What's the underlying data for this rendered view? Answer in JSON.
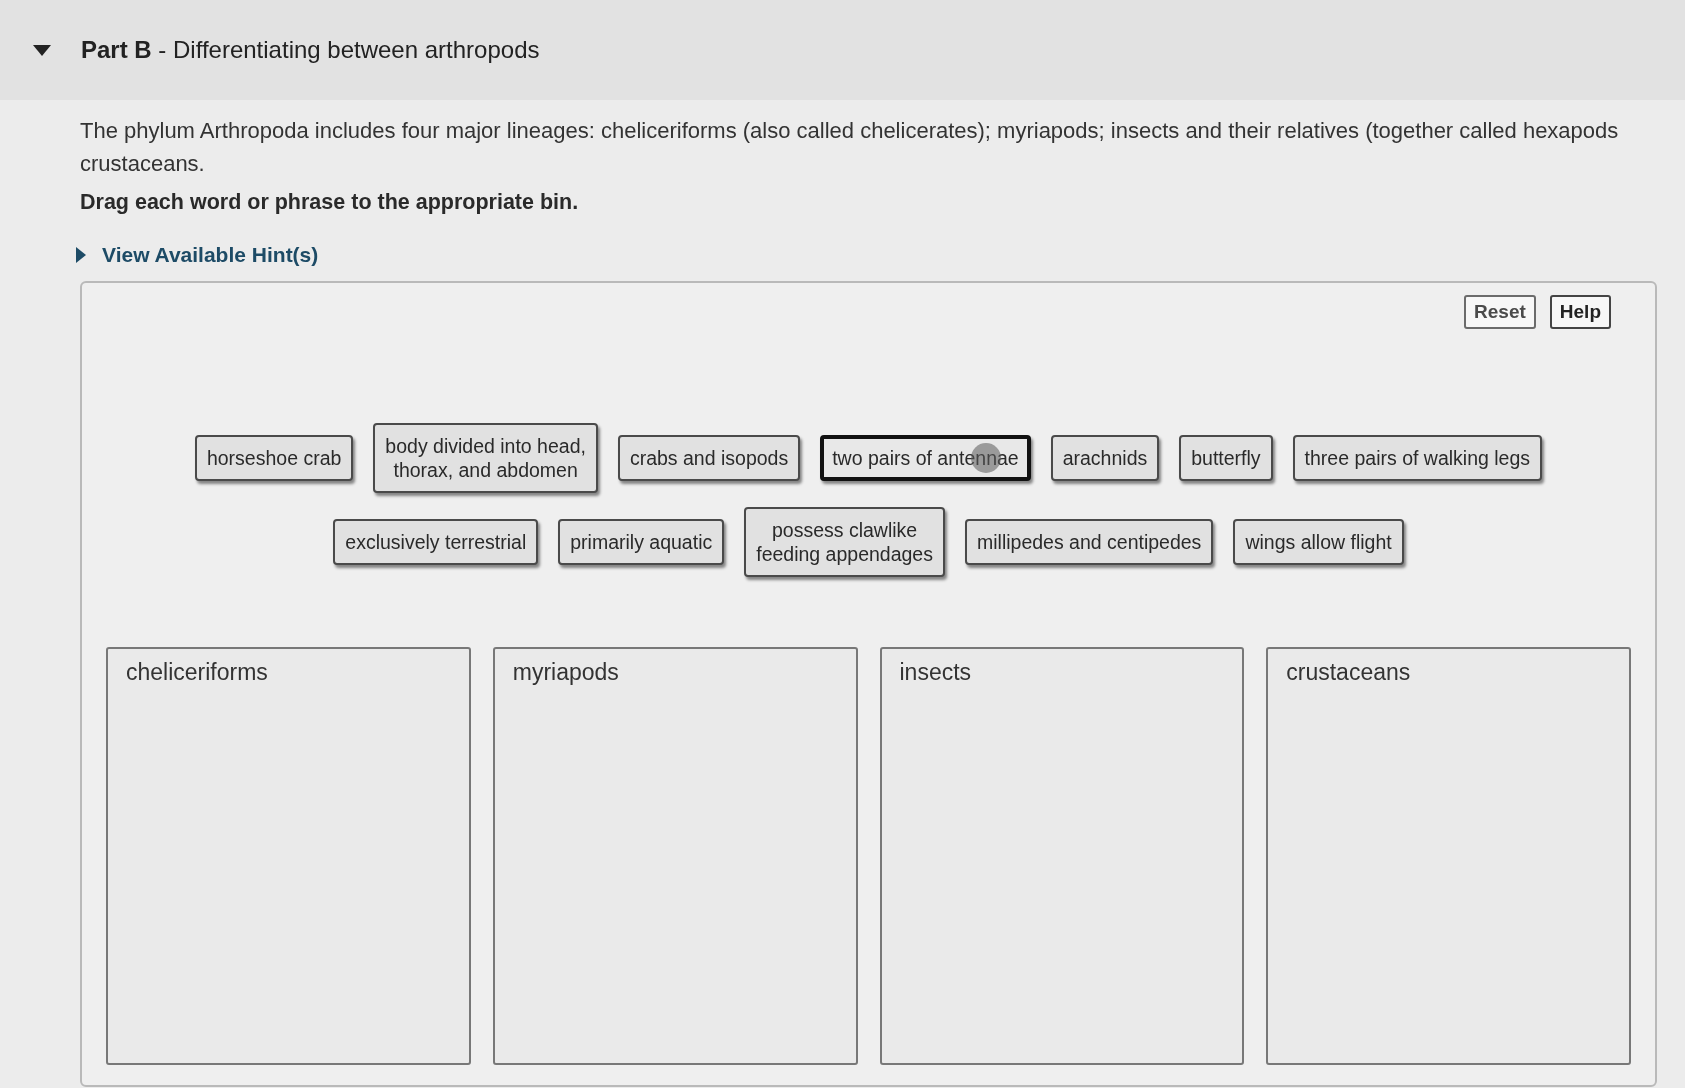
{
  "section": {
    "expanded": true,
    "title": "**Part B** - Differentiating between arthropods"
  },
  "intro": {
    "lines": [
      "The phylum Arthropoda includes four major lineages: cheliceriforms (also called chelicerates); myriapods; insects and their relatives (together called hexapods",
      "crustaceans."
    ]
  },
  "instruction": "Drag each word or phrase to the appropriate bin.",
  "hints": {
    "label": "View Available Hint(s)",
    "expanded": false
  },
  "buttons": [
    {
      "label": "Reset",
      "kind": "reset"
    },
    {
      "label": "Help",
      "kind": "help"
    }
  ],
  "tile_rows": [
    [
      {
        "label": "horseshoe crab",
        "selected": false
      },
      {
        "label": "body divided into head,\nthorax, and abdomen",
        "selected": false
      },
      {
        "label": "crabs and isopods",
        "selected": false
      },
      {
        "label": "two pairs of antennae",
        "selected": true
      },
      {
        "label": "arachnids",
        "selected": false
      },
      {
        "label": "butterfly",
        "selected": false
      },
      {
        "label": "three pairs of walking legs",
        "selected": false
      }
    ],
    [
      {
        "label": "exclusively terrestrial",
        "selected": false
      },
      {
        "label": "primarily aquatic",
        "selected": false
      },
      {
        "label": "possess clawlike\nfeeding appendages",
        "selected": false
      },
      {
        "label": "millipedes and centipedes",
        "selected": false
      },
      {
        "label": "wings allow flight",
        "selected": false
      }
    ]
  ],
  "bins": [
    {
      "label": "cheliceriforms"
    },
    {
      "label": "myriapods"
    },
    {
      "label": "insects"
    },
    {
      "label": "crustaceans"
    }
  ]
}
